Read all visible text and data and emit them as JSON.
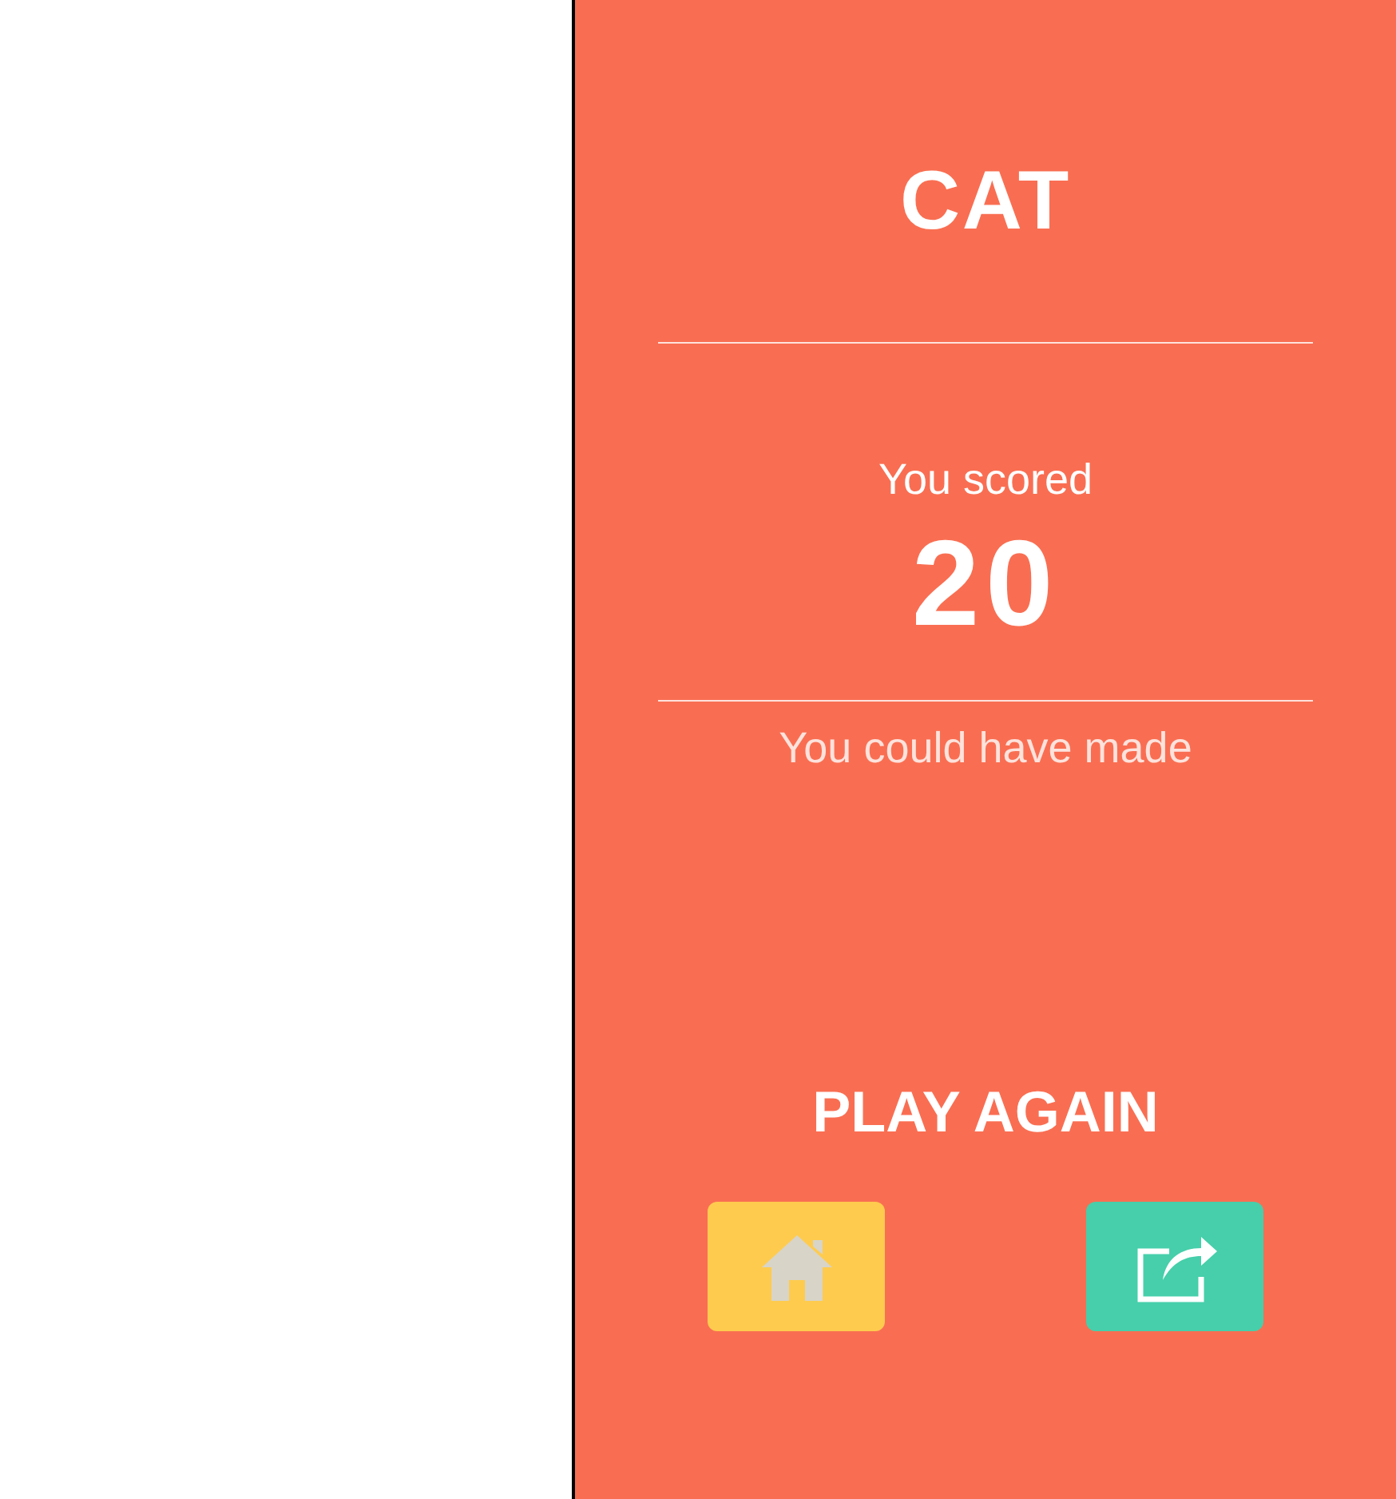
{
  "title": "CAT",
  "score_label": "You scored",
  "score": "20",
  "note": "You could have made",
  "play_again": "PLAY AGAIN",
  "buttons": [
    {
      "kind": "home"
    },
    {
      "kind": "share"
    }
  ]
}
